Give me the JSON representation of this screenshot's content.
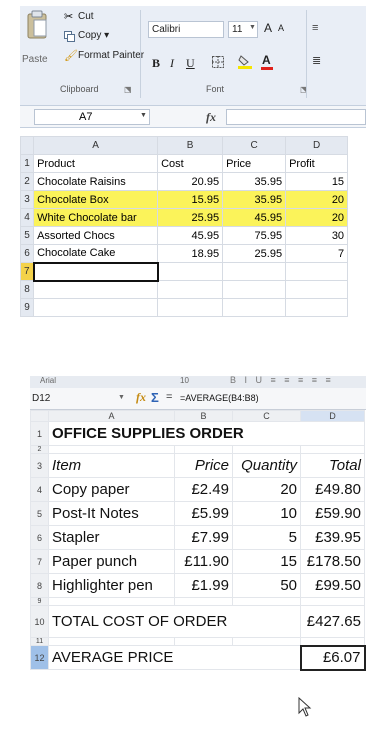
{
  "top": {
    "clipboard": {
      "paste_label": "Paste",
      "cut_label": "Cut",
      "copy_label": "Copy ▾",
      "format_painter_label": "Format Painter",
      "group_label": "Clipboard"
    },
    "font": {
      "font_name": "Calibri",
      "font_size": "11",
      "grow_label": "A",
      "shrink_label": "A",
      "bold_label": "B",
      "italic_label": "I",
      "underline_label": "U",
      "font_color_label": "A",
      "group_label": "Font"
    },
    "namebox": "A7",
    "fx_label": "fx",
    "columns": [
      "A",
      "B",
      "C",
      "D"
    ],
    "rows": [
      {
        "n": "1",
        "a": "Product",
        "b": "Cost",
        "c": "Price",
        "d": "Profit"
      },
      {
        "n": "2",
        "a": "Chocolate Raisins",
        "b": "20.95",
        "c": "35.95",
        "d": "15"
      },
      {
        "n": "3",
        "a": "Chocolate Box",
        "b": "15.95",
        "c": "35.95",
        "d": "20"
      },
      {
        "n": "4",
        "a": "White Chocolate bar",
        "b": "25.95",
        "c": "45.95",
        "d": "20"
      },
      {
        "n": "5",
        "a": "Assorted Chocs",
        "b": "45.95",
        "c": "75.95",
        "d": "30"
      },
      {
        "n": "6",
        "a": "Chocolate Cake",
        "b": "18.95",
        "c": "25.95",
        "d": "7"
      },
      {
        "n": "7",
        "a": "",
        "b": "",
        "c": "",
        "d": ""
      },
      {
        "n": "8",
        "a": "",
        "b": "",
        "c": "",
        "d": ""
      },
      {
        "n": "9",
        "a": "",
        "b": "",
        "c": "",
        "d": ""
      }
    ],
    "highlight_color": "#fbf35a"
  },
  "bottom": {
    "font_name": "Arial",
    "font_size": "10",
    "namebox": "D12",
    "formula": "=AVERAGE(B4:B8)",
    "columns": [
      "A",
      "B",
      "C",
      "D"
    ],
    "rows": [
      {
        "n": "1",
        "a": "OFFICE SUPPLIES ORDER",
        "b": "",
        "c": "",
        "d": ""
      },
      {
        "n": "2",
        "a": "",
        "b": "",
        "c": "",
        "d": ""
      },
      {
        "n": "3",
        "a": "Item",
        "b": "Price",
        "c": "Quantity",
        "d": "Total"
      },
      {
        "n": "4",
        "a": "Copy paper",
        "b": "£2.49",
        "c": "20",
        "d": "£49.80"
      },
      {
        "n": "5",
        "a": "Post-It Notes",
        "b": "£5.99",
        "c": "10",
        "d": "£59.90"
      },
      {
        "n": "6",
        "a": "Stapler",
        "b": "£7.99",
        "c": "5",
        "d": "£39.95"
      },
      {
        "n": "7",
        "a": "Paper punch",
        "b": "£11.90",
        "c": "15",
        "d": "£178.50"
      },
      {
        "n": "8",
        "a": "Highlighter pen",
        "b": "£1.99",
        "c": "50",
        "d": "£99.50"
      },
      {
        "n": "9",
        "a": "",
        "b": "",
        "c": "",
        "d": ""
      },
      {
        "n": "10",
        "a": "TOTAL COST OF ORDER",
        "b": "",
        "c": "",
        "d": "£427.65"
      },
      {
        "n": "11",
        "a": "",
        "b": "",
        "c": "",
        "d": ""
      },
      {
        "n": "12",
        "a": "AVERAGE PRICE",
        "b": "",
        "c": "",
        "d": "£6.07"
      }
    ]
  }
}
